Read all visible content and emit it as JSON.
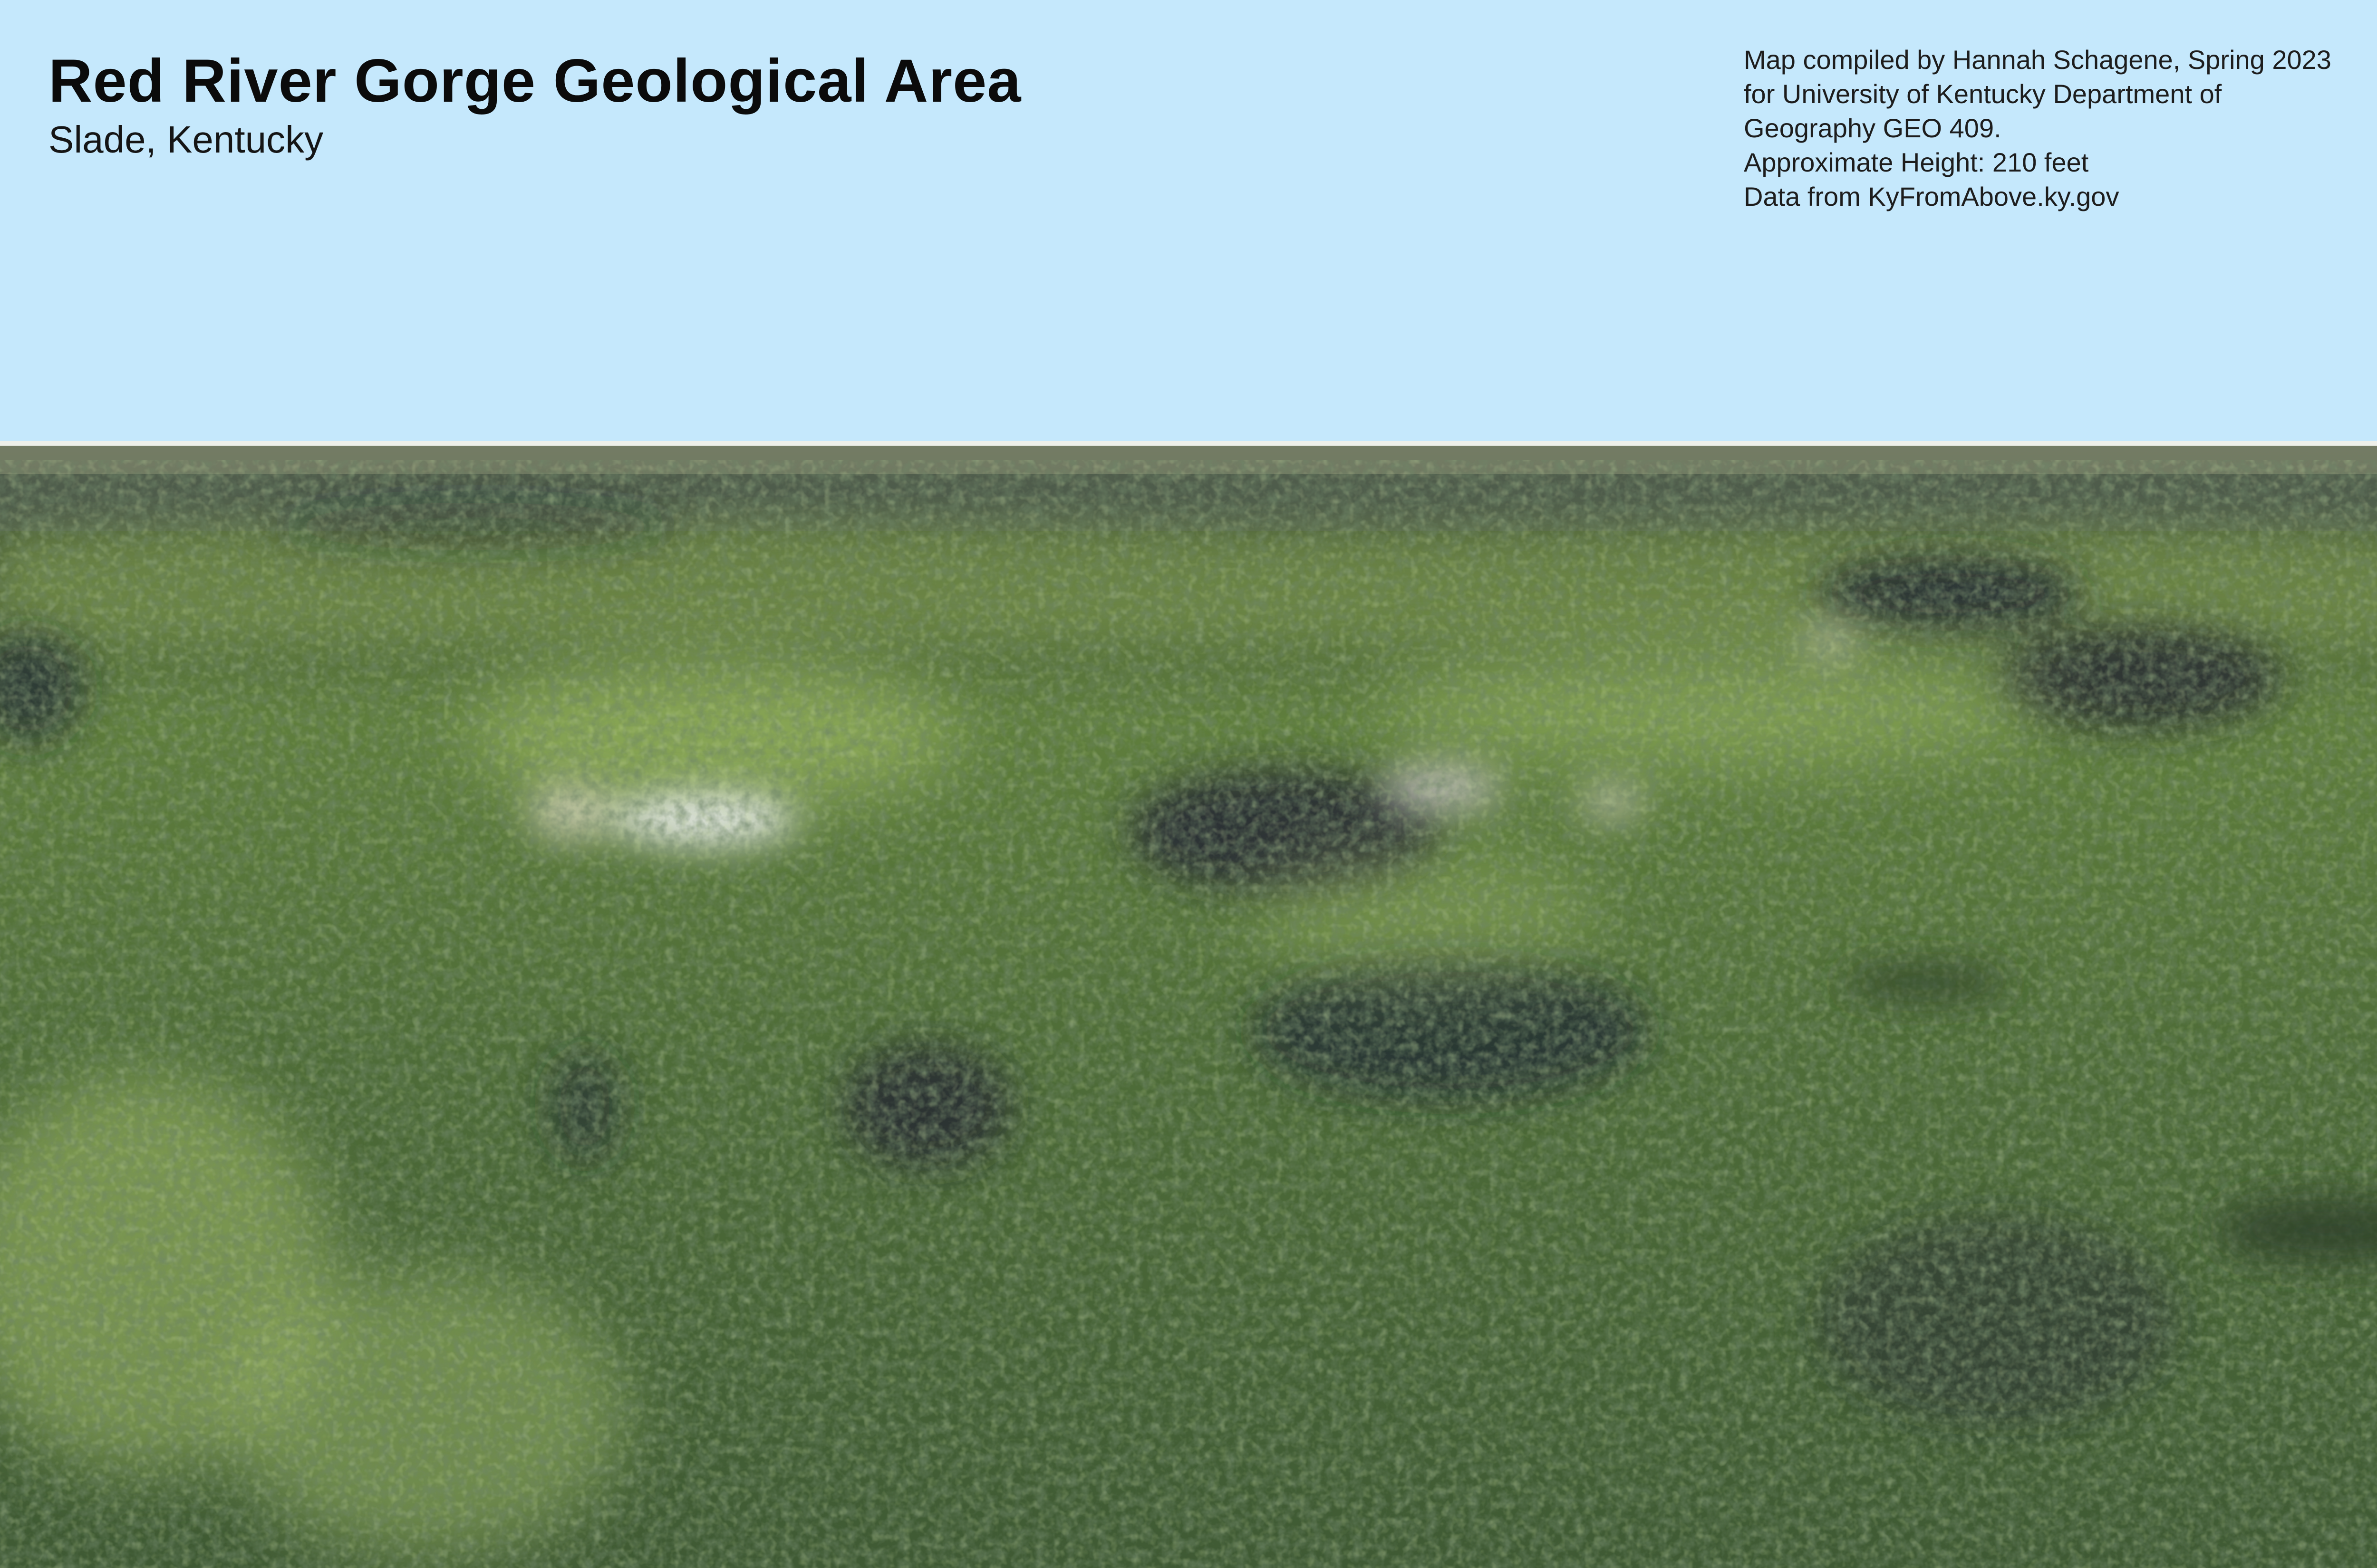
{
  "map": {
    "title": "Red River Gorge Geological Area",
    "subtitle": "Slade, Kentucky"
  },
  "credits": {
    "lines": [
      "Map compiled by Hannah Schagene, Spring 2023",
      "for University of Kentucky Department of",
      "Geography GEO 409.",
      "Approximate Height: 210 feet",
      "Data from KyFromAbove.ky.gov"
    ]
  },
  "colors": {
    "sky": "#c5e8fc",
    "forest_dark": "#2b3a2e",
    "forest_mid": "#4f6d3c",
    "forest_light": "#8aa65a",
    "shadow": "#1f2333",
    "cliff_light": "#e9ecef"
  },
  "layers": {
    "background": "sky",
    "basemap": "3d-aerial-imagery-forest-canopy"
  }
}
